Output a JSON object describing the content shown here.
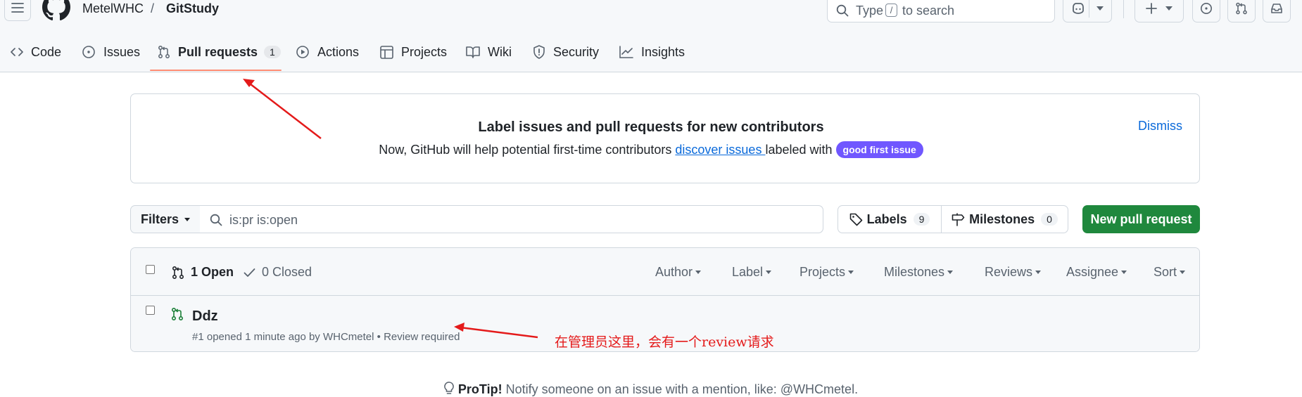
{
  "header": {
    "owner": "MetelWHC",
    "separator": "/",
    "repo": "GitStudy",
    "search_prefix": "Type",
    "search_key": "/",
    "search_suffix": "to search"
  },
  "nav": {
    "tabs": [
      {
        "label": "Code",
        "icon": "code-icon"
      },
      {
        "label": "Issues",
        "icon": "issue-opened-icon"
      },
      {
        "label": "Pull requests",
        "icon": "git-pull-request-icon",
        "count": "1",
        "active": true
      },
      {
        "label": "Actions",
        "icon": "play-icon"
      },
      {
        "label": "Projects",
        "icon": "table-icon"
      },
      {
        "label": "Wiki",
        "icon": "book-icon"
      },
      {
        "label": "Security",
        "icon": "shield-icon"
      },
      {
        "label": "Insights",
        "icon": "graph-icon"
      }
    ]
  },
  "banner": {
    "title": "Label issues and pull requests for new contributors",
    "desc_before": "Now, GitHub will help potential first-time contributors ",
    "link": "discover issues ",
    "desc_after": "labeled with ",
    "label": "good first issue",
    "dismiss": "Dismiss"
  },
  "filters": {
    "button": "Filters",
    "query": "is:pr is:open",
    "labels": "Labels",
    "labels_count": "9",
    "milestones": "Milestones",
    "milestones_count": "0",
    "new_pr": "New pull request"
  },
  "list": {
    "open": "1 Open",
    "closed": "0 Closed",
    "selectors": [
      "Author",
      "Label",
      "Projects",
      "Milestones",
      "Reviews",
      "Assignee",
      "Sort"
    ],
    "items": [
      {
        "title": "Ddz",
        "meta": "#1 opened 1 minute ago by WHCmetel • Review required"
      }
    ]
  },
  "annotation": {
    "text": "在管理员这里，会有一个review请求"
  },
  "protip": {
    "lead": "ProTip!",
    "text": " Notify someone on an issue with a mention, like: @WHCmetel."
  },
  "colors": {
    "accent_underline": "#fd8c73",
    "primary_button": "#1f883d",
    "link": "#0969da",
    "good_first_issue": "#7057ff",
    "open_icon": "#1a7f37",
    "annotation_red": "#e41a1a"
  }
}
